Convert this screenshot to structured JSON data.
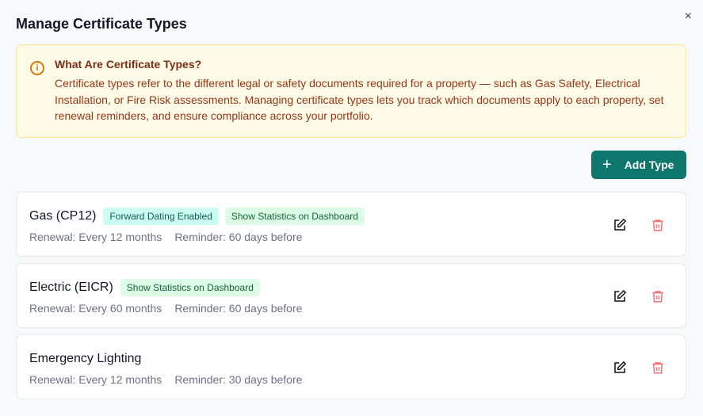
{
  "dialog": {
    "title": "Manage Certificate Types",
    "close": "×"
  },
  "info": {
    "heading": "What Are Certificate Types?",
    "body": "Certificate types refer to the different legal or safety documents required for a property — such as Gas Safety, Electrical Installation, or Fire Risk assessments. Managing certificate types lets you track which documents apply to each property, set renewal reminders, and ensure compliance across your portfolio."
  },
  "add_button": {
    "icon": "+",
    "label": "Add Type"
  },
  "types": [
    {
      "name": "Gas (CP12)",
      "badges": [
        "Forward Dating Enabled",
        "Show Statistics on Dashboard"
      ],
      "renewal": "Renewal: Every 12 months",
      "reminder": "Reminder: 60 days before"
    },
    {
      "name": "Electric (EICR)",
      "badges": [
        "Show Statistics on Dashboard"
      ],
      "renewal": "Renewal: Every 60 months",
      "reminder": "Reminder: 60 days before"
    },
    {
      "name": "Emergency Lighting",
      "badges": [],
      "renewal": "Renewal: Every 12 months",
      "reminder": "Reminder: 30 days before"
    }
  ]
}
